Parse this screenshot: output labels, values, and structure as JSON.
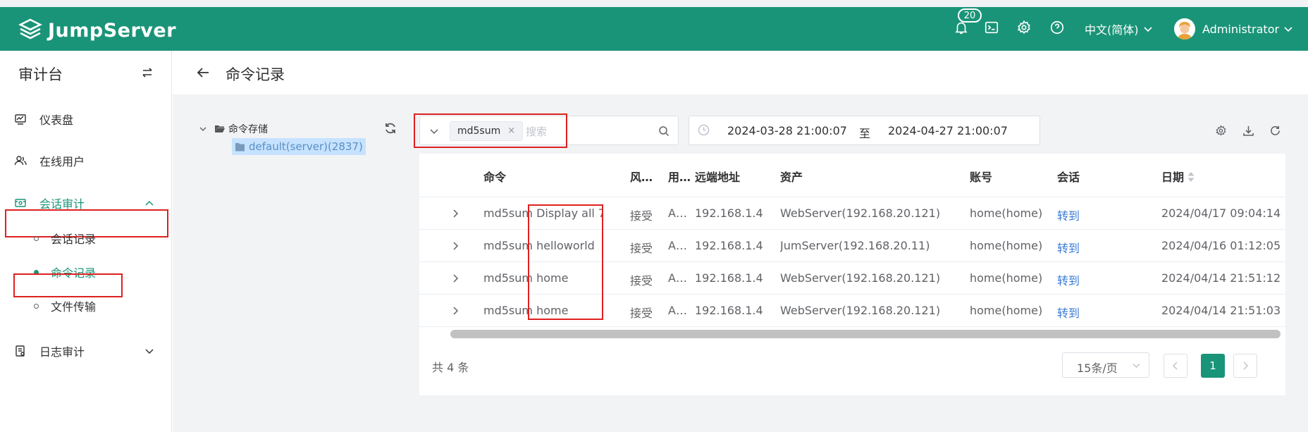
{
  "app": {
    "name": "JumpServer",
    "notification_count": "20",
    "language": "中文(简体)",
    "user_name": "Administrator"
  },
  "sidebar": {
    "title": "审计台",
    "items": [
      {
        "label": "仪表盘"
      },
      {
        "label": "在线用户"
      },
      {
        "label": "会话审计"
      },
      {
        "label": "日志审计"
      }
    ],
    "sub_items": [
      {
        "label": "会话记录"
      },
      {
        "label": "命令记录"
      },
      {
        "label": "文件传输"
      }
    ]
  },
  "page": {
    "title": "命令记录"
  },
  "tree": {
    "root": "命令存储",
    "child": "default(server)(2837)"
  },
  "search": {
    "tag": "md5sum",
    "tag_close": "×",
    "placeholder": "搜索"
  },
  "date_range": {
    "start": "2024-03-28 21:00:07",
    "separator": "至",
    "end": "2024-04-27 21:00:07"
  },
  "table": {
    "headers": {
      "command": "命令",
      "risk": "风…",
      "user": "用…",
      "remote": "远端地址",
      "asset": "资产",
      "account": "账号",
      "session": "会话",
      "date": "日期"
    },
    "rows": [
      {
        "command": "md5sum Display all 7…",
        "risk": "接受",
        "user": "A…",
        "remote": "192.168.1.4",
        "asset": "WebServer(192.168.20.121)",
        "account": "home(home)",
        "session": "转到",
        "date": "2024/04/17 09:04:14"
      },
      {
        "command": "md5sum helloworld",
        "risk": "接受",
        "user": "A…",
        "remote": "192.168.1.4",
        "asset": "JumServer(192.168.20.11)",
        "account": "home(home)",
        "session": "转到",
        "date": "2024/04/16 01:12:05"
      },
      {
        "command": "md5sum home",
        "risk": "接受",
        "user": "A…",
        "remote": "192.168.1.4",
        "asset": "WebServer(192.168.20.121)",
        "account": "home(home)",
        "session": "转到",
        "date": "2024/04/14 21:51:12"
      },
      {
        "command": "md5sum home",
        "risk": "接受",
        "user": "A…",
        "remote": "192.168.1.4",
        "asset": "WebServer(192.168.20.121)",
        "account": "home(home)",
        "session": "转到",
        "date": "2024/04/14 21:51:03"
      }
    ]
  },
  "pagination": {
    "total": "共 4 条",
    "page_size": "15条/页",
    "current_page": "1"
  },
  "colors": {
    "brand": "#1a9478",
    "link": "#3a7bd5",
    "highlight_box": "#e02020"
  }
}
